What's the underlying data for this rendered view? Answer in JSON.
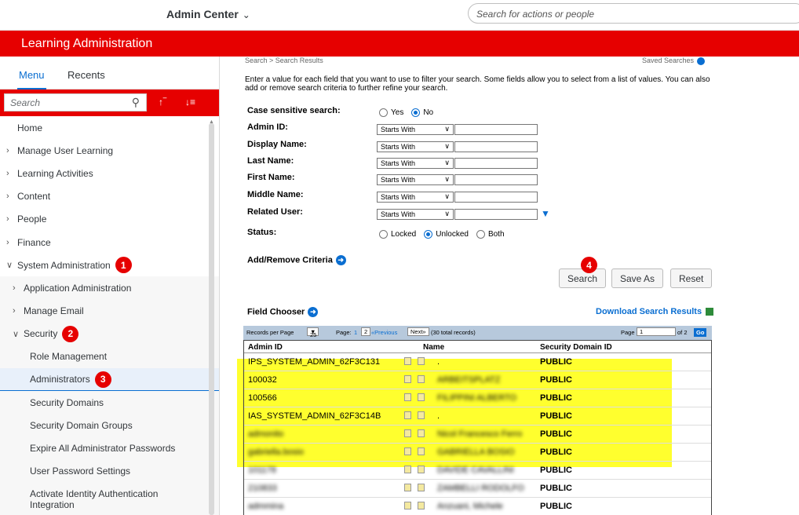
{
  "header": {
    "app_title": "Admin Center",
    "search_placeholder": "Search for actions or people"
  },
  "banner": {
    "title": "Learning Administration"
  },
  "sidebar": {
    "tabs": [
      "Menu",
      "Recents"
    ],
    "search_placeholder": "Search",
    "items": [
      {
        "label": "Home",
        "level": 0,
        "expandable": false
      },
      {
        "label": "Manage User Learning",
        "level": 0,
        "expandable": true
      },
      {
        "label": "Learning Activities",
        "level": 0,
        "expandable": true
      },
      {
        "label": "Content",
        "level": 0,
        "expandable": true
      },
      {
        "label": "People",
        "level": 0,
        "expandable": true
      },
      {
        "label": "Finance",
        "level": 0,
        "expandable": true
      },
      {
        "label": "System Administration",
        "level": 0,
        "expandable": true,
        "expanded": true,
        "badge": "1"
      },
      {
        "label": "Application Administration",
        "level": 1,
        "expandable": true
      },
      {
        "label": "Manage Email",
        "level": 1,
        "expandable": true
      },
      {
        "label": "Security",
        "level": 1,
        "expandable": true,
        "expanded": true,
        "badge": "2"
      },
      {
        "label": "Role Management",
        "level": 2
      },
      {
        "label": "Administrators",
        "level": 2,
        "selected": true,
        "badge": "3"
      },
      {
        "label": "Security Domains",
        "level": 2
      },
      {
        "label": "Security Domain Groups",
        "level": 2
      },
      {
        "label": "Expire All Administrator Passwords",
        "level": 2
      },
      {
        "label": "User Password Settings",
        "level": 2
      },
      {
        "label": "Activate Identity Authentication Integration",
        "level": 2
      }
    ]
  },
  "main": {
    "breadcrumb": "Search > Search Results",
    "saved_searches": "Saved Searches",
    "intro": "Enter a value for each field that you want to use to filter your search. Some fields allow you to select from a list of values. You can also add or remove search criteria to further refine your search.",
    "case_sensitive_label": "Case sensitive search:",
    "case_options": [
      "Yes",
      "No"
    ],
    "fields": [
      {
        "label": "Admin ID:",
        "operator": "Starts With"
      },
      {
        "label": "Display Name:",
        "operator": "Starts With"
      },
      {
        "label": "Last Name:",
        "operator": "Starts With"
      },
      {
        "label": "First Name:",
        "operator": "Starts With"
      },
      {
        "label": "Middle Name:",
        "operator": "Starts With"
      },
      {
        "label": "Related User:",
        "operator": "Starts With"
      }
    ],
    "status_label": "Status:",
    "status_options": [
      "Locked",
      "Unlocked",
      "Both"
    ],
    "add_remove": "Add/Remove Criteria",
    "buttons": {
      "search": "Search",
      "save_as": "Save As",
      "reset": "Reset",
      "search_badge": "4"
    },
    "field_chooser": "Field Chooser",
    "download": "Download Search Results",
    "pager": {
      "records_per_page_label": "Records per Page",
      "records_per_page": "25",
      "page_label": "Page:",
      "page_1": "1",
      "page_2": "2",
      "previous": "«Previous",
      "next": "Next»",
      "total": "(30 total records)",
      "page_word": "Page",
      "current_page": "1",
      "of_pages": "of 2",
      "go": "Go"
    },
    "columns": [
      "Admin ID",
      "Name",
      "Security Domain ID"
    ],
    "rows": [
      {
        "id": "IPS_SYSTEM_ADMIN_62F3C131",
        "name": ".",
        "domain": "PUBLIC",
        "blur_id": false,
        "blur_name": false
      },
      {
        "id": "100032",
        "name": "ARBEITSPLATZ",
        "domain": "PUBLIC",
        "blur_id": false,
        "blur_name": true
      },
      {
        "id": "100566",
        "name": "FILIPPINI ALBERTO",
        "domain": "PUBLIC",
        "blur_id": false,
        "blur_name": true
      },
      {
        "id": "IAS_SYSTEM_ADMIN_62F3C14B",
        "name": ".",
        "domain": "PUBLIC",
        "blur_id": false,
        "blur_name": false
      },
      {
        "id": "admonito",
        "name": "Nicol Francesco Ferro",
        "domain": "PUBLIC",
        "blur_id": true,
        "blur_name": true
      },
      {
        "id": "gabriella.bosio",
        "name": "GABRIELLA BOSIO",
        "domain": "PUBLIC",
        "blur_id": true,
        "blur_name": true
      },
      {
        "id": "101178",
        "name": "DAVIDE CAVALLINI",
        "domain": "PUBLIC",
        "blur_id": true,
        "blur_name": true
      },
      {
        "id": "210833",
        "name": "ZAMBELLI RODOLFO",
        "domain": "PUBLIC",
        "blur_id": true,
        "blur_name": true
      },
      {
        "id": "admmina",
        "name": "Anzuani, Michele",
        "domain": "PUBLIC",
        "blur_id": true,
        "blur_name": true
      }
    ]
  },
  "colors": {
    "brand_red": "#e60000",
    "accent_blue": "#0a6ed1",
    "highlight_yellow": "#ffff00"
  }
}
